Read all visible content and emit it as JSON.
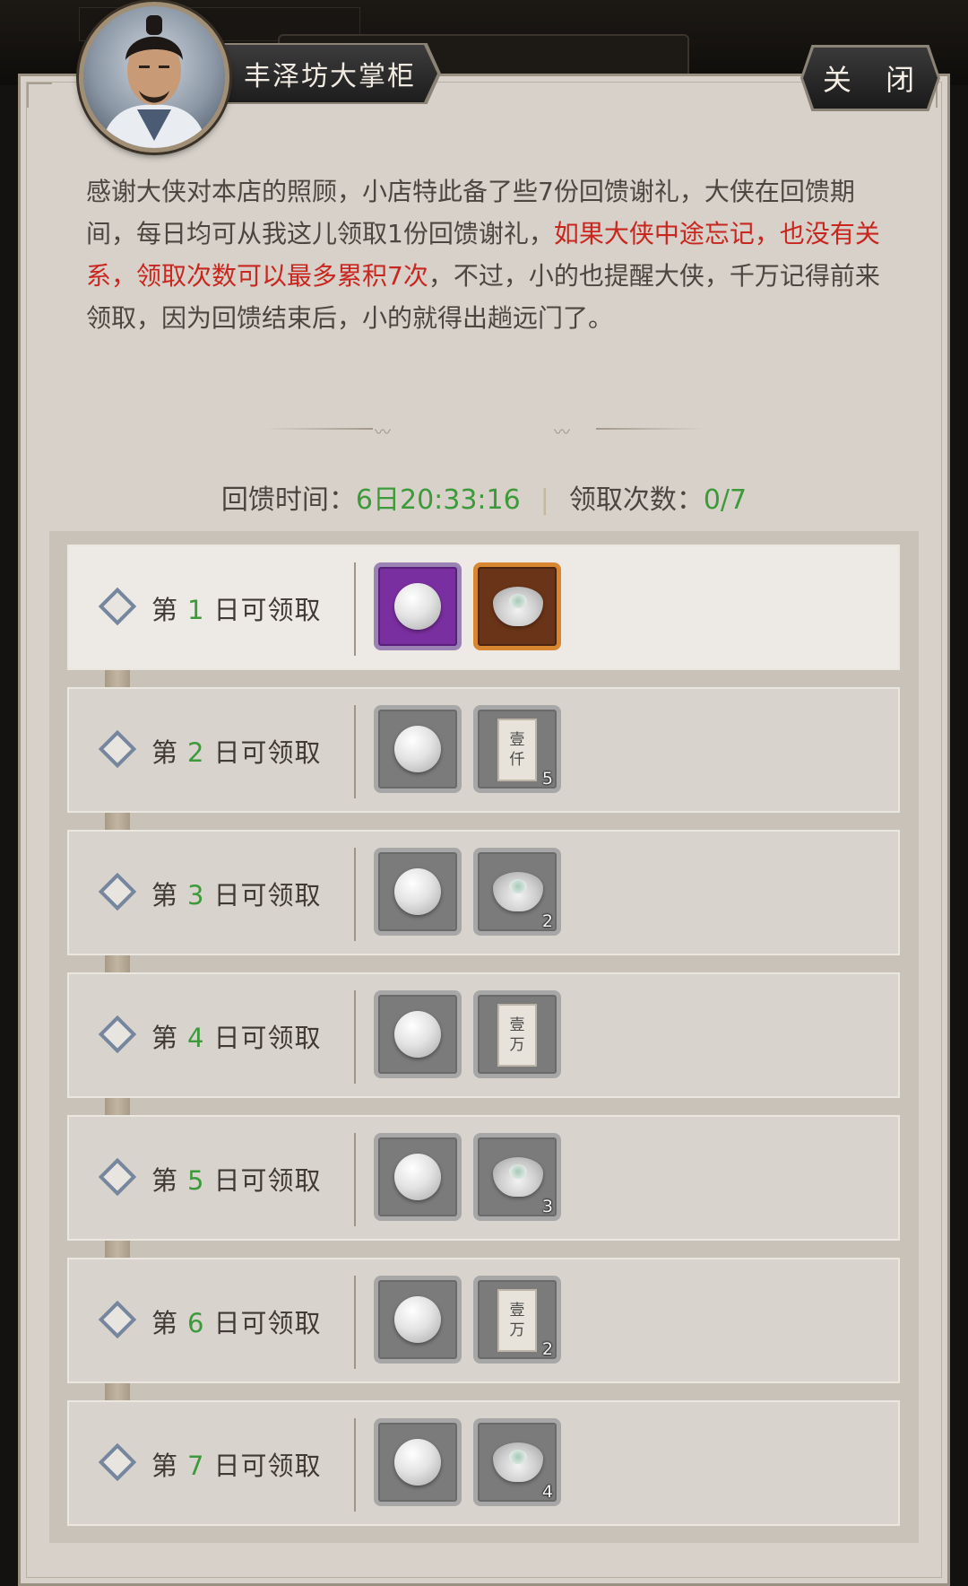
{
  "npc": {
    "name": "丰泽坊大掌柜"
  },
  "close_label": "关 闭",
  "description": {
    "part1": "感谢大侠对本店的照顾，小店特此备了些7份回馈谢礼，大侠在回馈期间，每日均可从我这儿领取1份回馈谢礼，",
    "highlight": "如果大侠中途忘记，也没有关系，领取次数可以最多累积7次",
    "part2": "，不过，小的也提醒大侠，千万记得前来领取，因为回馈结束后，小的就得出趟远门了。"
  },
  "status": {
    "time_label": "回馈时间：",
    "time_value": "6日20:33:16",
    "separator": "|",
    "count_label": "领取次数：",
    "count_value": "0/7"
  },
  "rewards": [
    {
      "prefix": "第",
      "day": "1",
      "suffix": "日可领取",
      "active": true,
      "items": [
        {
          "icon": "pearl-icon",
          "rarity": "purple",
          "qty": ""
        },
        {
          "icon": "silver-ingot-icon",
          "rarity": "orange",
          "qty": ""
        }
      ]
    },
    {
      "prefix": "第",
      "day": "2",
      "suffix": "日可领取",
      "active": false,
      "items": [
        {
          "icon": "pearl-icon",
          "rarity": "grey",
          "qty": ""
        },
        {
          "icon": "banknote-icon",
          "rarity": "grey",
          "qty": "5",
          "note": [
            "壹",
            "仟"
          ]
        }
      ]
    },
    {
      "prefix": "第",
      "day": "3",
      "suffix": "日可领取",
      "active": false,
      "items": [
        {
          "icon": "pearl-icon",
          "rarity": "grey",
          "qty": ""
        },
        {
          "icon": "silver-ingot-icon",
          "rarity": "grey",
          "qty": "2"
        }
      ]
    },
    {
      "prefix": "第",
      "day": "4",
      "suffix": "日可领取",
      "active": false,
      "items": [
        {
          "icon": "pearl-icon",
          "rarity": "grey",
          "qty": ""
        },
        {
          "icon": "banknote-icon",
          "rarity": "grey",
          "qty": "",
          "note": [
            "壹",
            "万"
          ]
        }
      ]
    },
    {
      "prefix": "第",
      "day": "5",
      "suffix": "日可领取",
      "active": false,
      "items": [
        {
          "icon": "pearl-icon",
          "rarity": "grey",
          "qty": ""
        },
        {
          "icon": "silver-ingot-icon",
          "rarity": "grey",
          "qty": "3"
        }
      ]
    },
    {
      "prefix": "第",
      "day": "6",
      "suffix": "日可领取",
      "active": false,
      "items": [
        {
          "icon": "pearl-icon",
          "rarity": "grey",
          "qty": ""
        },
        {
          "icon": "banknote-icon",
          "rarity": "grey",
          "qty": "2",
          "note": [
            "壹",
            "万"
          ]
        }
      ]
    },
    {
      "prefix": "第",
      "day": "7",
      "suffix": "日可领取",
      "active": false,
      "items": [
        {
          "icon": "pearl-icon",
          "rarity": "grey",
          "qty": ""
        },
        {
          "icon": "silver-ingot-icon",
          "rarity": "grey",
          "qty": "4"
        }
      ]
    }
  ]
}
